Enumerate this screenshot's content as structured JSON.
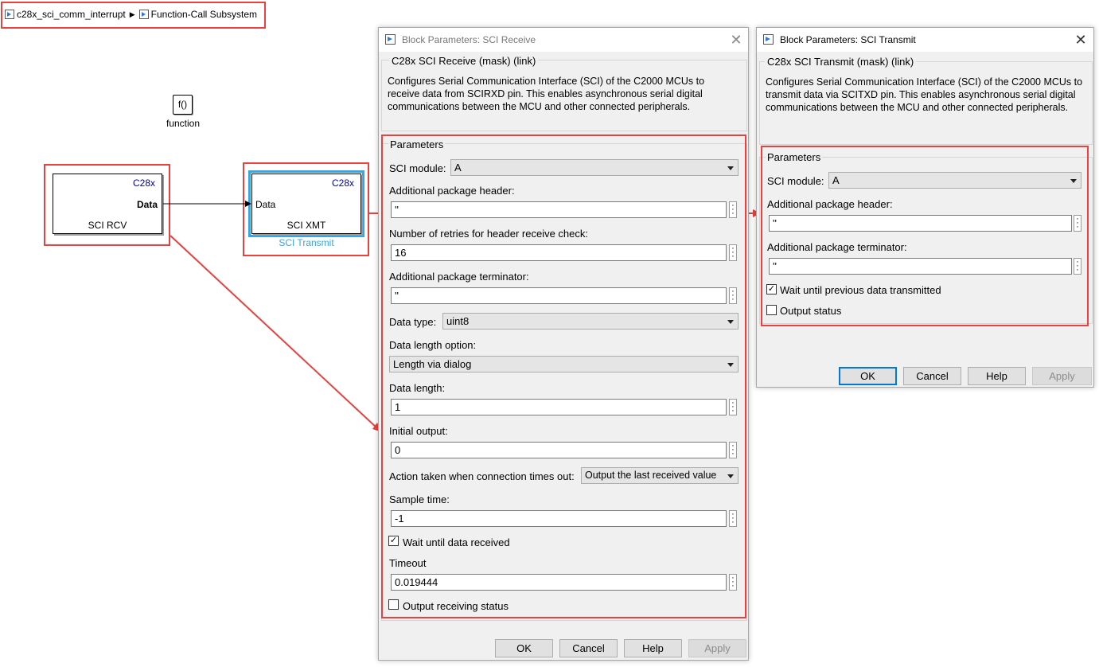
{
  "breadcrumb": {
    "model": "c28x_sci_comm_interrupt",
    "subsystem": "Function-Call Subsystem"
  },
  "canvas": {
    "function_block": {
      "icon_text": "f()",
      "label": "function"
    },
    "rcv_block": {
      "tag": "C28x",
      "port": "Data",
      "name": "SCI RCV"
    },
    "xmt_block": {
      "tag": "C28x",
      "port": "Data",
      "name": "SCI XMT",
      "label": "SCI Transmit"
    }
  },
  "receive_dialog": {
    "title": "Block Parameters: SCI Receive",
    "mask": "C28x SCI Receive (mask) (link)",
    "description": "Configures Serial Communication Interface (SCI) of the C2000 MCUs to receive data from SCIRXD pin. This enables asynchronous serial digital communications between the MCU and other connected peripherals.",
    "params_title": "Parameters",
    "sci_module_label": "SCI module:",
    "sci_module_value": "A",
    "header_label": "Additional package header:",
    "header_value": "''",
    "retries_label": "Number of retries for header receive check:",
    "retries_value": "16",
    "terminator_label": "Additional package terminator:",
    "terminator_value": "''",
    "data_type_label": "Data type:",
    "data_type_value": "uint8",
    "length_option_label": "Data length option:",
    "length_option_value": "Length via dialog",
    "data_length_label": "Data length:",
    "data_length_value": "1",
    "initial_output_label": "Initial output:",
    "initial_output_value": "0",
    "action_label": "Action taken when connection times out:",
    "action_value": "Output the last received value",
    "sample_time_label": "Sample time:",
    "sample_time_value": "-1",
    "wait_label": "Wait until data received",
    "wait_checked": true,
    "timeout_label": "Timeout",
    "timeout_value": "0.019444",
    "output_status_label": "Output receiving status",
    "output_status_checked": false,
    "buttons": {
      "ok": "OK",
      "cancel": "Cancel",
      "help": "Help",
      "apply": "Apply"
    }
  },
  "transmit_dialog": {
    "title": "Block Parameters: SCI Transmit",
    "mask": "C28x SCI Transmit (mask) (link)",
    "description": "Configures Serial Communication Interface (SCI) of the C2000 MCUs to transmit data via SCITXD pin. This enables asynchronous serial digital communications between the MCU and other connected peripherals.",
    "params_title": "Parameters",
    "sci_module_label": "SCI module:",
    "sci_module_value": "A",
    "header_label": "Additional package header:",
    "header_value": "''",
    "terminator_label": "Additional package terminator:",
    "terminator_value": "''",
    "wait_label": "Wait until previous data transmitted",
    "wait_checked": true,
    "output_status_label": "Output status",
    "output_status_checked": false,
    "buttons": {
      "ok": "OK",
      "cancel": "Cancel",
      "help": "Help",
      "apply": "Apply"
    }
  },
  "colors": {
    "highlight_red": "#e8413e",
    "selection_blue": "#33a6e8",
    "block_tag_blue": "#0000a0"
  }
}
